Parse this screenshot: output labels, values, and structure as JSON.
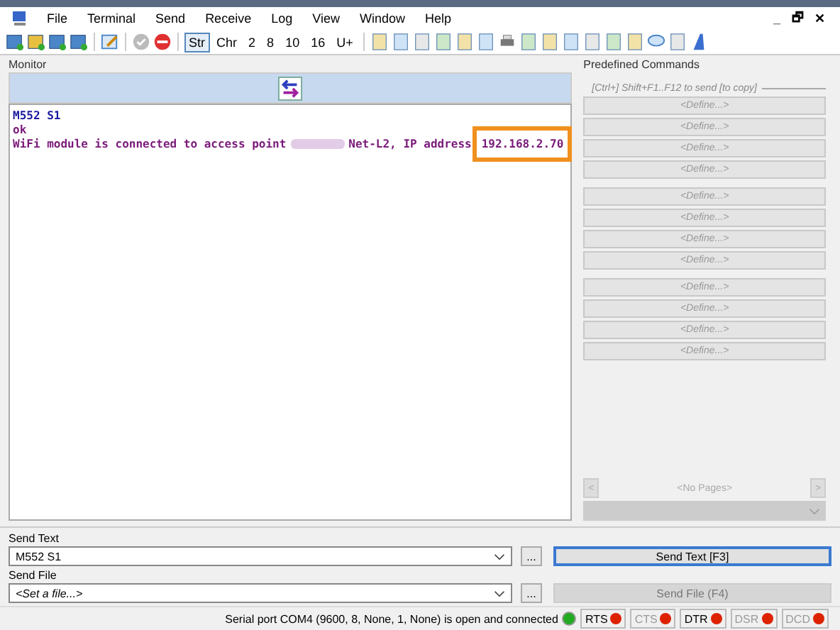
{
  "menu": [
    "File",
    "Terminal",
    "Send",
    "Receive",
    "Log",
    "View",
    "Window",
    "Help"
  ],
  "window_controls": [
    "_",
    "🗗",
    "✕"
  ],
  "format_buttons": [
    {
      "label": "Str",
      "selected": true
    },
    {
      "label": "Chr",
      "selected": false
    },
    {
      "label": "2",
      "selected": false
    },
    {
      "label": "8",
      "selected": false
    },
    {
      "label": "10",
      "selected": false
    },
    {
      "label": "16",
      "selected": false
    },
    {
      "label": "U+",
      "selected": false
    }
  ],
  "monitor": {
    "title": "Monitor",
    "lines": [
      {
        "kind": "sent",
        "text": "M552 S1"
      },
      {
        "kind": "received",
        "text": "ok"
      },
      {
        "kind": "redacted",
        "before": "WiFi module is connected to access point",
        "after": "Net-L2, IP address",
        "highlight": "192.168.2.70"
      }
    ]
  },
  "predefined": {
    "title": "Predefined Commands",
    "hint": "[Ctrl+] Shift+F1..F12 to send [to copy]",
    "groups": [
      [
        "<Define...>",
        "<Define...>",
        "<Define...>",
        "<Define...>"
      ],
      [
        "<Define...>",
        "<Define...>",
        "<Define...>",
        "<Define...>"
      ],
      [
        "<Define...>",
        "<Define...>",
        "<Define...>",
        "<Define...>"
      ]
    ],
    "pager": {
      "prev": "<",
      "label": "<No Pages>",
      "next": ">"
    }
  },
  "send_text": {
    "title": "Send Text",
    "value": "M552 S1",
    "browse": "...",
    "button": "Send Text [F3]",
    "disabled": false
  },
  "send_file": {
    "title": "Send File",
    "placeholder": "<Set a file...>",
    "browse": "...",
    "button": "Send File (F4)",
    "disabled": true
  },
  "status_bar": {
    "message": "Serial port COM4 (9600, 8, None, 1, None) is open and connected",
    "connected": true,
    "signals": [
      {
        "label": "RTS",
        "enabled": true
      },
      {
        "label": "CTS",
        "enabled": false
      },
      {
        "label": "DTR",
        "enabled": true
      },
      {
        "label": "DSR",
        "enabled": false
      },
      {
        "label": "DCD",
        "enabled": false
      }
    ]
  }
}
